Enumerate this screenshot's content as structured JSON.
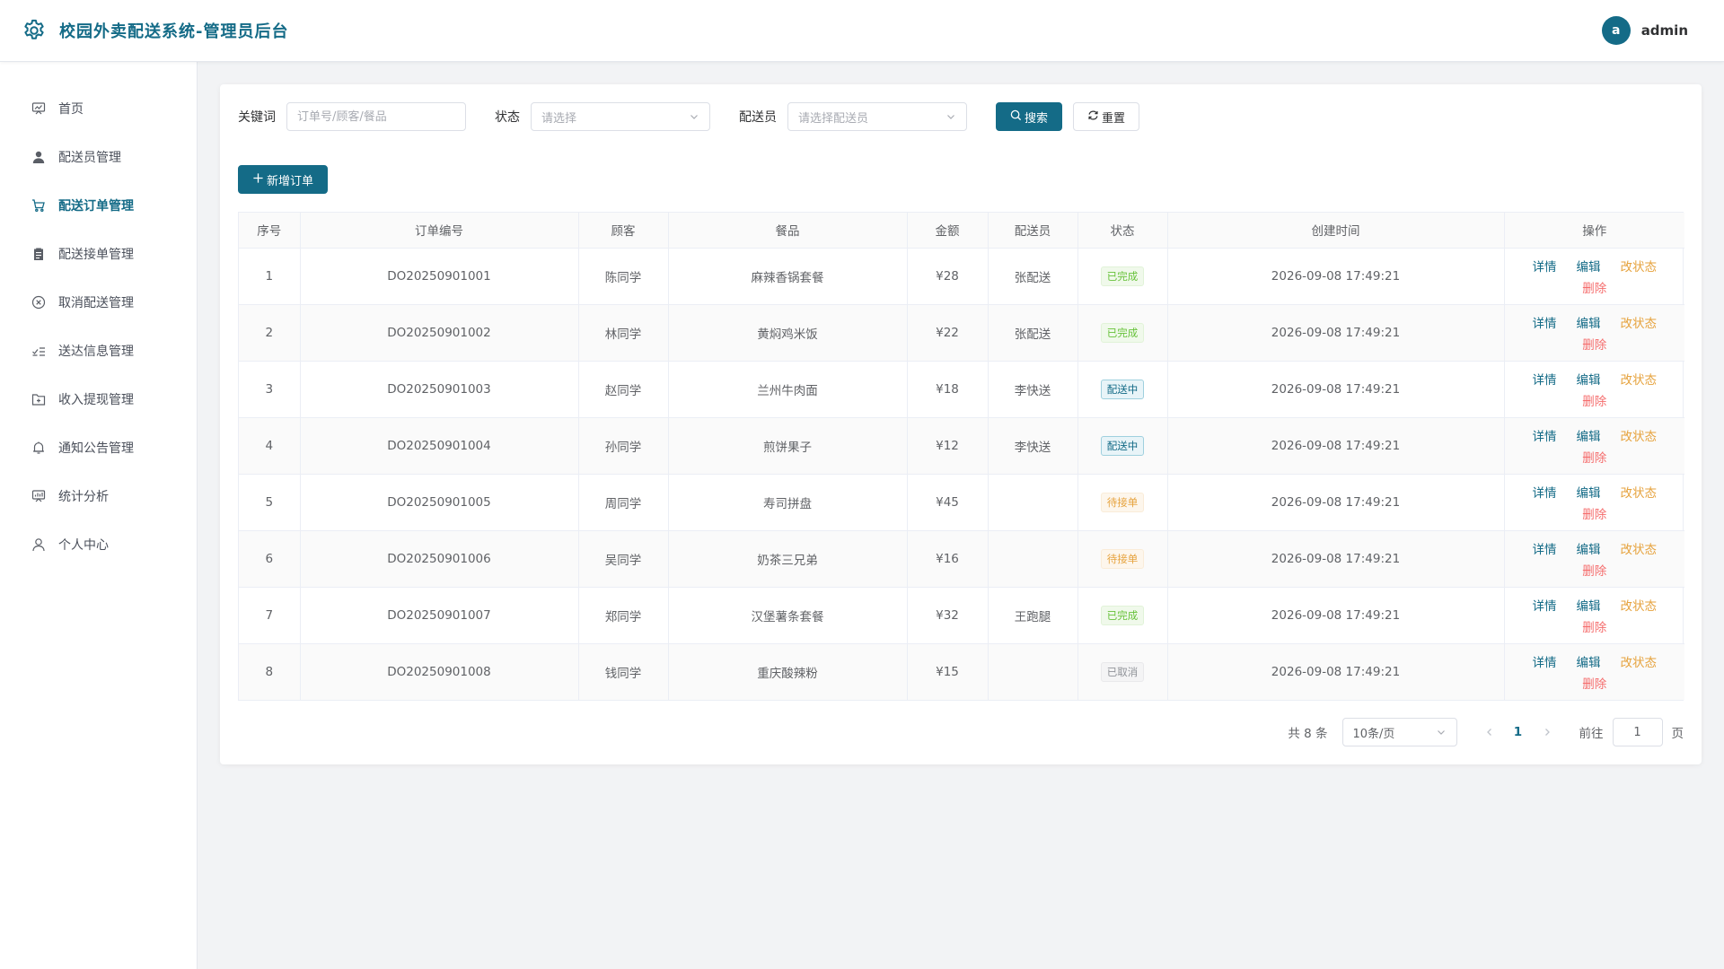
{
  "header": {
    "title": "校园外卖配送系统-管理员后台",
    "avatar_letter": "a",
    "username": "admin"
  },
  "theme": {
    "primary": "#146b87",
    "success": "#67c23a",
    "warning": "#e6a23c",
    "danger": "#f56c6c",
    "info": "#909399"
  },
  "sidebar": {
    "items": [
      {
        "label": "首页",
        "icon": "dashboard-icon"
      },
      {
        "label": "配送员管理",
        "icon": "user-icon"
      },
      {
        "label": "配送订单管理",
        "icon": "cart-icon",
        "active": true
      },
      {
        "label": "配送接单管理",
        "icon": "clipboard-icon"
      },
      {
        "label": "取消配送管理",
        "icon": "circle-close-icon"
      },
      {
        "label": "送达信息管理",
        "icon": "checklist-icon"
      },
      {
        "label": "收入提现管理",
        "icon": "folder-icon"
      },
      {
        "label": "通知公告管理",
        "icon": "bell-icon"
      },
      {
        "label": "统计分析",
        "icon": "chart-board-icon"
      },
      {
        "label": "个人中心",
        "icon": "person-icon"
      }
    ]
  },
  "filters": {
    "keyword_label": "关键词",
    "keyword_placeholder": "订单号/顾客/餐品",
    "keyword_value": "",
    "status_label": "状态",
    "status_placeholder": "请选择",
    "rider_label": "配送员",
    "rider_placeholder": "请选择配送员",
    "search_label": "搜索",
    "reset_label": "重置"
  },
  "add_button_label": "新增订单",
  "table": {
    "columns": [
      "序号",
      "订单编号",
      "顾客",
      "餐品",
      "金额",
      "配送员",
      "状态",
      "创建时间",
      "操作"
    ],
    "actions": {
      "detail": "详情",
      "edit": "编辑",
      "status": "改状态",
      "delete": "删除"
    },
    "rows": [
      {
        "idx": "1",
        "order_no": "DO20250901001",
        "customer": "陈同学",
        "meal": "麻辣香锅套餐",
        "amount": "¥28",
        "rider": "张配送",
        "status": "已完成",
        "status_type": "done",
        "created": "2026-09-08 17:49:21"
      },
      {
        "idx": "2",
        "order_no": "DO20250901002",
        "customer": "林同学",
        "meal": "黄焖鸡米饭",
        "amount": "¥22",
        "rider": "张配送",
        "status": "已完成",
        "status_type": "done",
        "created": "2026-09-08 17:49:21"
      },
      {
        "idx": "3",
        "order_no": "DO20250901003",
        "customer": "赵同学",
        "meal": "兰州牛肉面",
        "amount": "¥18",
        "rider": "李快送",
        "status": "配送中",
        "status_type": "delivering",
        "created": "2026-09-08 17:49:21"
      },
      {
        "idx": "4",
        "order_no": "DO20250901004",
        "customer": "孙同学",
        "meal": "煎饼果子",
        "amount": "¥12",
        "rider": "李快送",
        "status": "配送中",
        "status_type": "delivering",
        "created": "2026-09-08 17:49:21"
      },
      {
        "idx": "5",
        "order_no": "DO20250901005",
        "customer": "周同学",
        "meal": "寿司拼盘",
        "amount": "¥45",
        "rider": "",
        "status": "待接单",
        "status_type": "waiting",
        "created": "2026-09-08 17:49:21"
      },
      {
        "idx": "6",
        "order_no": "DO20250901006",
        "customer": "吴同学",
        "meal": "奶茶三兄弟",
        "amount": "¥16",
        "rider": "",
        "status": "待接单",
        "status_type": "waiting",
        "created": "2026-09-08 17:49:21"
      },
      {
        "idx": "7",
        "order_no": "DO20250901007",
        "customer": "郑同学",
        "meal": "汉堡薯条套餐",
        "amount": "¥32",
        "rider": "王跑腿",
        "status": "已完成",
        "status_type": "done",
        "created": "2026-09-08 17:49:21"
      },
      {
        "idx": "8",
        "order_no": "DO20250901008",
        "customer": "钱同学",
        "meal": "重庆酸辣粉",
        "amount": "¥15",
        "rider": "",
        "status": "已取消",
        "status_type": "cancel",
        "created": "2026-09-08 17:49:21"
      }
    ]
  },
  "pagination": {
    "total_text": "共 8 条",
    "page_size": "10条/页",
    "current_page": "1",
    "goto_prefix": "前往",
    "goto_value": "1",
    "goto_suffix": "页"
  }
}
